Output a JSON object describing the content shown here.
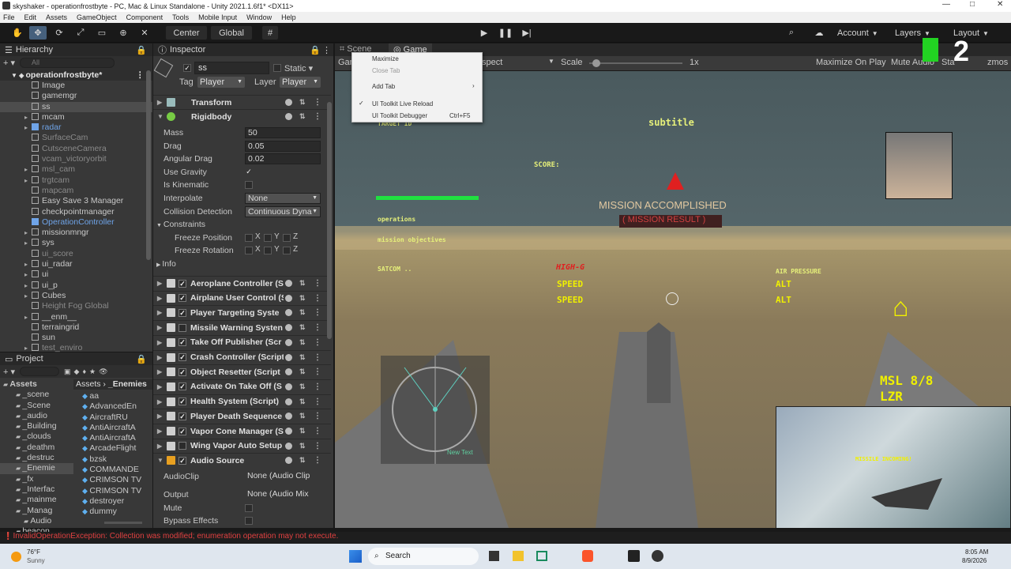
{
  "window": {
    "title": "skyshaker - operationfrostbyte - PC, Mac & Linux Standalone - Unity 2021.1.6f1* <DX11>"
  },
  "menu": [
    "File",
    "Edit",
    "Assets",
    "GameObject",
    "Component",
    "Tools",
    "Mobile Input",
    "Window",
    "Help"
  ],
  "toolbar": {
    "center": "Center",
    "global": "Global",
    "account": "Account",
    "layers": "Layers",
    "layout": "Layout"
  },
  "hierarchy": {
    "title": "Hierarchy",
    "search_placeholder": "All",
    "scene": "operationfrostbyte*",
    "items": [
      {
        "label": "Image",
        "style": "normal",
        "expand": false
      },
      {
        "label": "gamemgr",
        "style": "normal",
        "expand": false
      },
      {
        "label": "ss",
        "style": "selected",
        "expand": false
      },
      {
        "label": "mcam",
        "style": "normal",
        "expand": true
      },
      {
        "label": "radar",
        "style": "blue",
        "expand": true
      },
      {
        "label": "SurfaceCam",
        "style": "muted",
        "expand": false
      },
      {
        "label": "CutsceneCamera",
        "style": "muted",
        "expand": false
      },
      {
        "label": "vcam_victoryorbit",
        "style": "muted",
        "expand": false
      },
      {
        "label": "msl_cam",
        "style": "muted",
        "expand": true
      },
      {
        "label": "trgtcam",
        "style": "muted",
        "expand": true
      },
      {
        "label": "mapcam",
        "style": "muted",
        "expand": false
      },
      {
        "label": "Easy Save 3 Manager",
        "style": "normal",
        "expand": false
      },
      {
        "label": "checkpointmanager",
        "style": "normal",
        "expand": false
      },
      {
        "label": "OperationController",
        "style": "blue",
        "expand": false
      },
      {
        "label": "missionmngr",
        "style": "normal",
        "expand": true
      },
      {
        "label": "sys",
        "style": "normal",
        "expand": true
      },
      {
        "label": "ui_score",
        "style": "muted",
        "expand": false
      },
      {
        "label": "ui_radar",
        "style": "normal",
        "expand": true
      },
      {
        "label": "ui",
        "style": "normal",
        "expand": true
      },
      {
        "label": "ui_p",
        "style": "normal",
        "expand": true
      },
      {
        "label": "Cubes",
        "style": "normal",
        "expand": true
      },
      {
        "label": "Height Fog Global",
        "style": "muted",
        "expand": false
      },
      {
        "label": "__enm__",
        "style": "normal",
        "expand": true
      },
      {
        "label": "terraingrid",
        "style": "normal",
        "expand": false
      },
      {
        "label": "sun",
        "style": "normal",
        "expand": false
      },
      {
        "label": "test_enviro",
        "style": "muted",
        "expand": true
      }
    ]
  },
  "project": {
    "title": "Project",
    "tree": [
      "Assets",
      "_scene",
      "_Scene",
      "_audio",
      "_Building",
      "_clouds",
      "_deathm",
      "_destruc",
      "_Enemie",
      "_fx",
      "_Interfac",
      "_mainme",
      "_Manag",
      "Audio",
      "beacon"
    ],
    "breadcrumb": [
      "Assets",
      "_Enemies"
    ],
    "files": [
      "aa",
      "AdvancedEn",
      "AircraftRU",
      "AntiAircraftA",
      "AntiAircraftA",
      "ArcadeFlight",
      "bzsk",
      "COMMANDE",
      "CRIMSON TV",
      "CRIMSON TV",
      "destroyer",
      "dummy"
    ]
  },
  "inspector": {
    "title": "Inspector",
    "object_name": "ss",
    "static_label": "Static",
    "tag_label": "Tag",
    "tag_value": "Player",
    "layer_label": "Layer",
    "layer_value": "Player",
    "transform": "Transform",
    "rigidbody": "Rigidbody",
    "fields": [
      {
        "label": "Mass",
        "value": "50"
      },
      {
        "label": "Drag",
        "value": "0.05"
      },
      {
        "label": "Angular Drag",
        "value": "0.02"
      }
    ],
    "use_gravity": "Use Gravity",
    "is_kinematic": "Is Kinematic",
    "interpolate": "Interpolate",
    "interpolate_value": "None",
    "collision": "Collision Detection",
    "collision_value": "Continuous Dyna",
    "constraints": "Constraints",
    "freeze_position": "Freeze Position",
    "freeze_rotation": "Freeze Rotation",
    "x": "X",
    "y": "Y",
    "z": "Z",
    "info": "Info",
    "components": [
      "Aeroplane Controller (S",
      "Airplane User Control (S",
      "Player Targeting Syste",
      "Missile Warning Systen",
      "Take Off Publisher (Scr",
      "Crash Controller (Script",
      "Object Resetter (Script",
      "Activate On Take Off (S",
      "Health System (Script)",
      "Player Death Sequence",
      "Vapor Cone Manager (S",
      "Wing Vapor Auto Setup"
    ],
    "audio_source": "Audio Source",
    "audio_fields": [
      {
        "label": "AudioClip",
        "value": "None (Audio Clip"
      },
      {
        "label": "Output",
        "value": "None (Audio Mix"
      }
    ],
    "mute": "Mute",
    "bypass": "Bypass Effects"
  },
  "gameview": {
    "tab_scene": "Scene",
    "tab_game": "Game",
    "display_trunc": "Gam",
    "aspect_trunc": "spect",
    "scale_label": "Scale",
    "scale_value": "1x",
    "scale_fraction": 0.03,
    "maximize": "Maximize On Play",
    "mute": "Mute Audio",
    "stats": "Sta",
    "gizmos": "zmos",
    "context_menu": [
      "Maximize",
      "Close Tab",
      "Add Tab",
      "UI Toolkit Live Reload",
      "UI Toolkit Debugger"
    ],
    "shortcut": "Ctrl+F5"
  },
  "hud": {
    "target_id": "TARGET ID",
    "subtitle": "subtitle",
    "score": "SCORE:",
    "mission": "MISSION ACCOMPLISHED",
    "mission_sub": "( MISSION RESULT )",
    "operations": "operations",
    "objectives": "mission objectives",
    "satcom": "SATCOM ..",
    "high_g": "HIGH-G",
    "speed1": "SPEED",
    "speed2": "SPEED",
    "air_pressure": "AIR PRESSURE",
    "alt1": "ALT",
    "alt2": "ALT",
    "msl": "MSL 8/8",
    "lzr": "LZR",
    "radar_text": "New Text",
    "pip_alert": "MISSILE INCOMING!"
  },
  "overlay_badge": "2",
  "console_error": "InvalidOperationException: Collection was modified; enumeration operation may not execute.",
  "taskbar": {
    "temp": "76°F",
    "weather": "Sunny",
    "search": "Search",
    "time": "8:05 AM",
    "date": "8/9/2026"
  },
  "colors": {
    "hud_green": "#e6f07a",
    "hud_yellow": "#f0f000",
    "hud_red": "#e02020",
    "accent": "#46607c"
  }
}
